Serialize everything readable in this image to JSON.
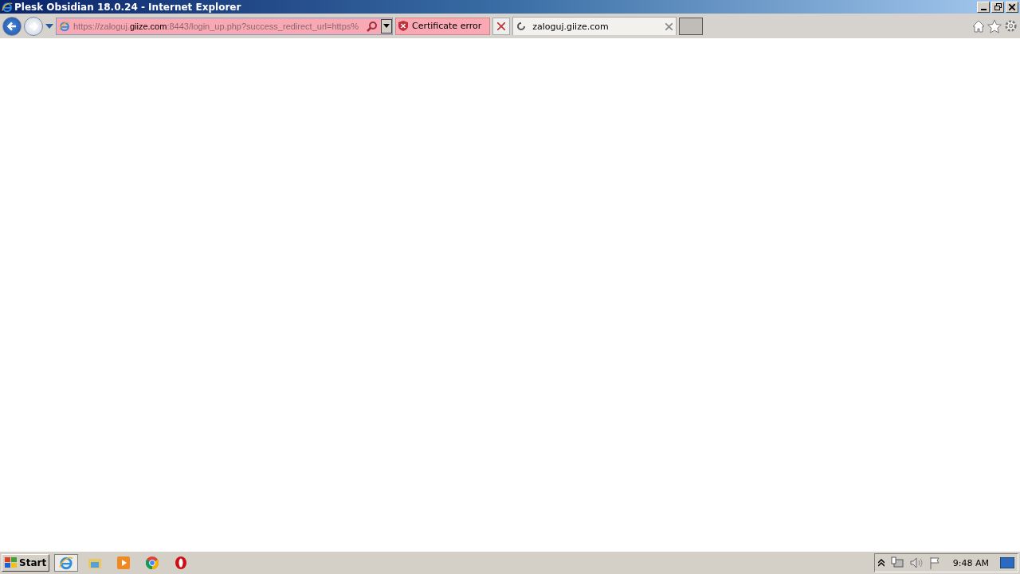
{
  "window": {
    "title": "Plesk Obsidian 18.0.24 - Internet Explorer"
  },
  "address_bar": {
    "url_parts": [
      {
        "text": "https://zaloguj.",
        "kind": "dim"
      },
      {
        "text": "giize.com",
        "kind": "domain"
      },
      {
        "text": ":8443/login_up.php?success_redirect_url=https%",
        "kind": "dim"
      }
    ],
    "certificate_error": "Certificate error"
  },
  "tabs": [
    {
      "label": "zaloguj.giize.com",
      "selected": true,
      "loading": true
    }
  ],
  "taskbar": {
    "start": "Start",
    "apps": [
      {
        "kind": "ie",
        "selected": true
      },
      {
        "kind": "folder",
        "selected": false
      },
      {
        "kind": "media",
        "selected": false
      },
      {
        "kind": "chrome",
        "selected": false
      },
      {
        "kind": "opera",
        "selected": false
      }
    ],
    "clock": "9:48 AM"
  }
}
